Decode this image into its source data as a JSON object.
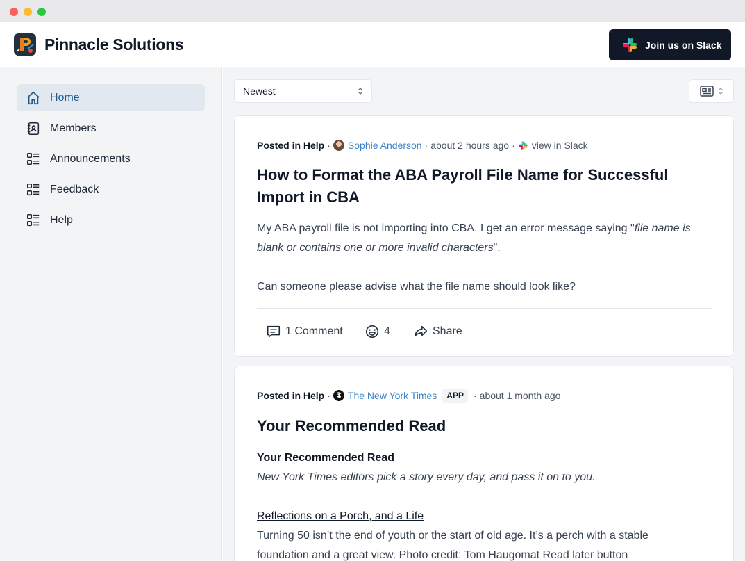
{
  "header": {
    "brand": "Pinnacle Solutions",
    "slack_button": "Join us on Slack"
  },
  "sidebar": {
    "items": [
      {
        "label": "Home",
        "icon": "home-icon",
        "active": true
      },
      {
        "label": "Members",
        "icon": "contacts-book-icon"
      },
      {
        "label": "Announcements",
        "icon": "list-icon"
      },
      {
        "label": "Feedback",
        "icon": "list-icon"
      },
      {
        "label": "Help",
        "icon": "list-icon"
      }
    ]
  },
  "toolbar": {
    "sort_value": "Newest"
  },
  "posts": [
    {
      "posted_in_label": "Posted in Help",
      "author": "Sophie Anderson",
      "time": "about 2 hours ago",
      "slack_link": "view in Slack",
      "title": "How to Format the ABA Payroll File Name for Successful Import in CBA",
      "body_prefix": "My ABA payroll file is not importing into CBA. I get an error message saying \"",
      "body_quote": "file name is blank or contains one or more invalid characters",
      "body_suffix": "\".",
      "body_question": "Can someone please advise what the file name should look like?",
      "comments": "1 Comment",
      "reactions": "4",
      "share": "Share"
    },
    {
      "posted_in_label": "Posted in Help",
      "author": "The New York Times",
      "badge": "APP",
      "time": "about 1 month ago",
      "title": "Your Recommended Read",
      "subtitle": "Your Recommended Read",
      "tagline": "New York Times editors pick a story every day, and pass it on to you.",
      "link_title": "Reflections on a Porch, and a Life",
      "body_line1": "Turning 50 isn’t the end of youth or the start of old age. It’s a perch with a stable",
      "body_line2": "foundation and a great view. Photo credit: Tom Haugomat   Read later button"
    }
  ],
  "colors": {
    "accent": "#1e5a8a",
    "link": "#3b82c4",
    "slack_button_bg": "#111827",
    "sidebar_bg": "#f3f4f6"
  }
}
